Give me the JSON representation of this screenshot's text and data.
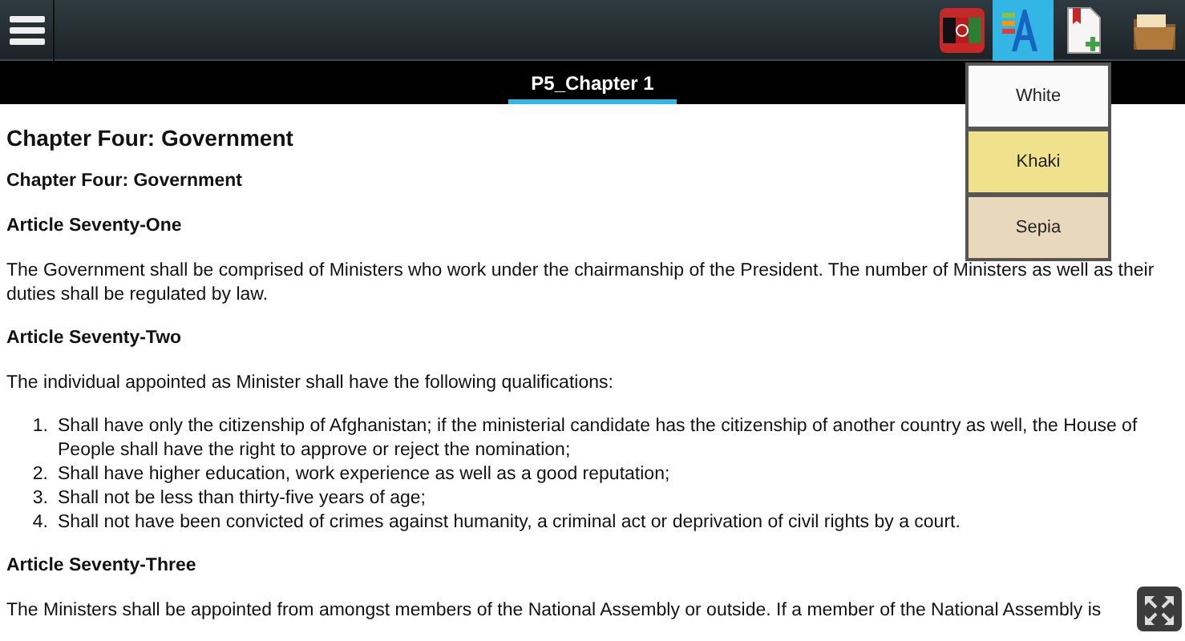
{
  "toolbar": {
    "actions": [
      {
        "kind": "flag",
        "selected": false
      },
      {
        "kind": "font",
        "selected": true
      },
      {
        "kind": "bookmark-add",
        "selected": false
      },
      {
        "kind": "folder",
        "selected": false
      }
    ]
  },
  "tabs": [
    {
      "label": "P5_Chapter 1",
      "selected": true
    }
  ],
  "theme_menu": {
    "items": [
      {
        "label": "White",
        "color": "#fafafa"
      },
      {
        "label": "Khaki",
        "color": "#f0e28c"
      },
      {
        "label": "Sepia",
        "color": "#e8d9bd"
      }
    ]
  },
  "content": [
    {
      "kind": "heading",
      "text": "Chapter Four: Government"
    },
    {
      "kind": "subheading",
      "text": "Chapter Four: Government"
    },
    {
      "kind": "subheading",
      "text": "Article Seventy-One"
    },
    {
      "kind": "paragraph",
      "text": "The Government shall be comprised of Ministers who work under the chairmanship of the President. The number of Ministers as well as their duties shall be regulated by law."
    },
    {
      "kind": "subheading",
      "text": "Article Seventy-Two"
    },
    {
      "kind": "paragraph",
      "text": "The individual appointed as Minister shall have the following qualifications:"
    },
    {
      "kind": "list",
      "items": [
        {
          "marker": "1.",
          "text": "Shall have only the citizenship of Afghanistan; if the ministerial candidate has the citizenship of another country as well, the House of People shall have the right to approve or reject the nomination;"
        },
        {
          "marker": "2.",
          "text": "Shall have higher education, work experience as well as a good reputation;"
        },
        {
          "marker": "3.",
          "text": "Shall not be less than thirty-five years of age;"
        },
        {
          "marker": "4.",
          "text": "Shall not have been convicted of crimes against humanity, a criminal act or deprivation of civil rights by a court."
        }
      ]
    },
    {
      "kind": "subheading",
      "text": "Article Seventy-Three"
    },
    {
      "kind": "paragraph",
      "text": "The Ministers shall be appointed from amongst members of the National Assembly or outside.  If a member of the National Assembly is"
    }
  ]
}
